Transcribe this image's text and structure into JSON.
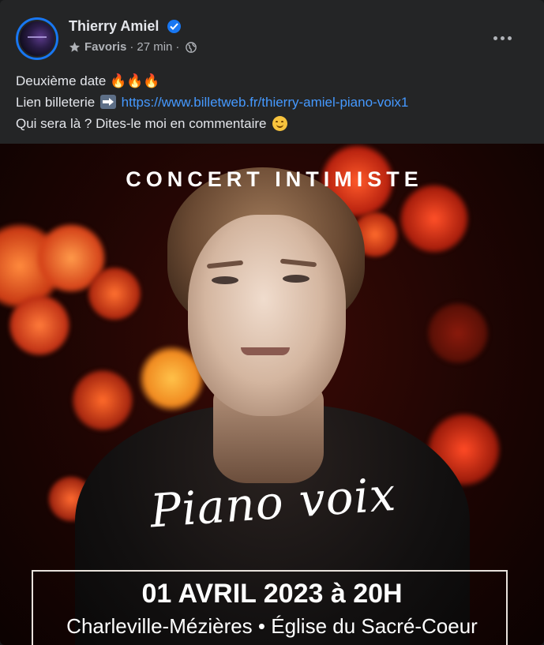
{
  "header": {
    "author_name": "Thierry Amiel",
    "audience": "Favoris",
    "separator": "·",
    "time": "27 min",
    "more_button": "•••"
  },
  "post": {
    "line1_text": "Deuxième date ",
    "line1_emoji": "🔥🔥🔥",
    "line2_prefix": "Lien billeterie ",
    "line2_link": "https://www.billetweb.fr/thierry-amiel-piano-voix1",
    "line3_text": "Qui sera là ? Dites-le moi en commentaire "
  },
  "poster": {
    "title": "CONCERT INTIMISTE",
    "script_text": "Piano voix",
    "date": "01 AVRIL 2023 à 20H",
    "venue": "Charleville-Mézières • Église du Sacré-Coeur"
  },
  "colors": {
    "background": "#242526",
    "primary_text": "#e4e6eb",
    "secondary_text": "#b0b3b8",
    "link": "#4599ff",
    "verified": "#1877f2"
  },
  "icons": [
    "verified-icon",
    "star-icon",
    "globe-icon",
    "more-icon",
    "fire-emoji",
    "right-arrow-emoji",
    "smiling-face-emoji"
  ]
}
